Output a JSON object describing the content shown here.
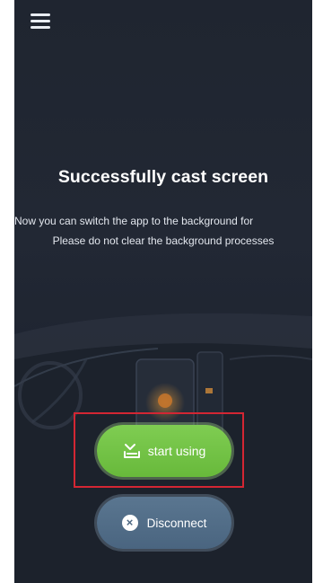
{
  "header": {
    "menu_icon": "hamburger-menu-icon"
  },
  "cast": {
    "title": "Successfully cast screen",
    "line_1": "Now you can switch the app to the background for",
    "line_2": "Please do not clear the background processes"
  },
  "actions": {
    "start_label": "start using",
    "start_icon": "check-tray-icon",
    "disconnect_label": "Disconnect",
    "disconnect_icon": "close-circle-icon"
  },
  "colors": {
    "background": "#1f2530",
    "start_green": "#6fbf45",
    "disconnect_blue": "#4f6a85",
    "highlight_red": "#d32633"
  }
}
